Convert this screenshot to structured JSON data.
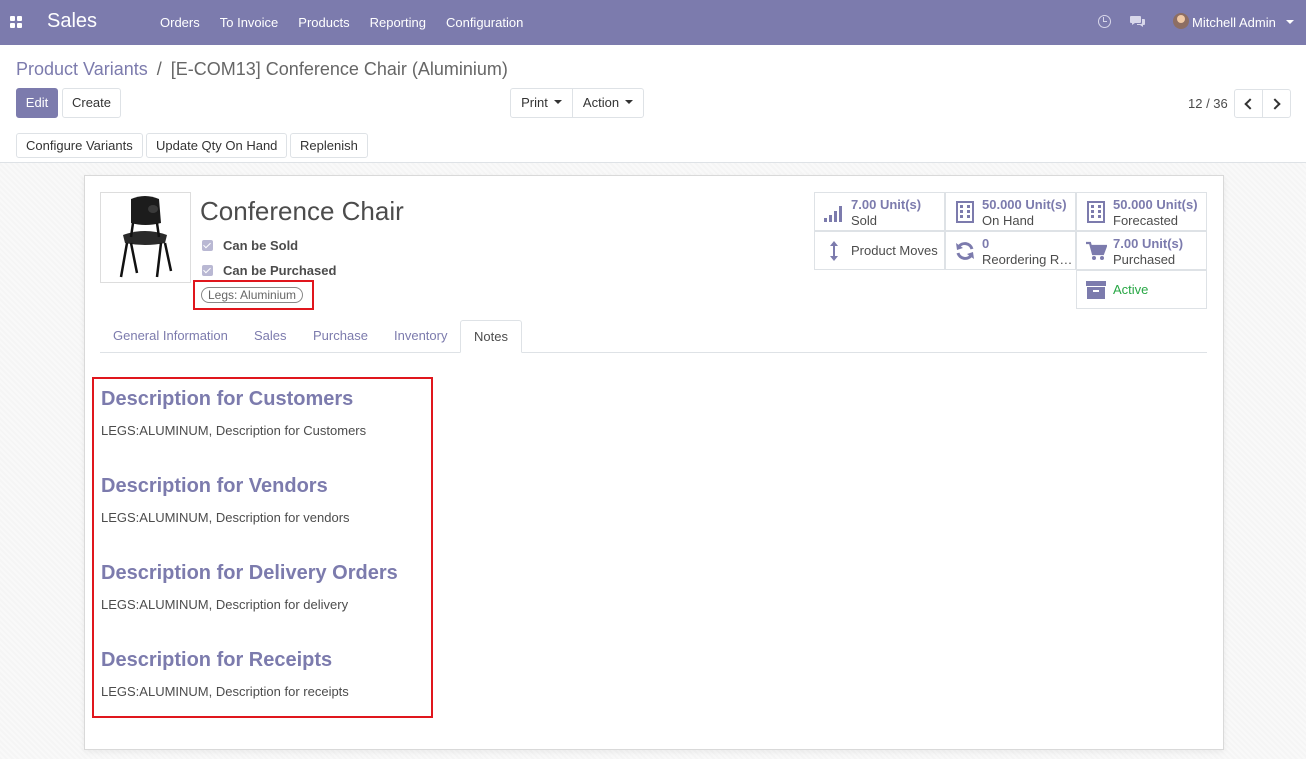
{
  "navbar": {
    "app_name": "Sales",
    "menu": [
      "Orders",
      "To Invoice",
      "Products",
      "Reporting",
      "Configuration"
    ],
    "user": "Mitchell Admin",
    "color": "#7c7bad"
  },
  "breadcrumb": {
    "parent": "Product Variants",
    "separator": "/",
    "current": "[E-COM13] Conference Chair (Aluminium)"
  },
  "buttons": {
    "edit": "Edit",
    "create": "Create",
    "print": "Print",
    "action": "Action"
  },
  "pager": {
    "value": "12 / 36"
  },
  "statusbar": {
    "configure_variants": "Configure Variants",
    "update_qty": "Update Qty On Hand",
    "replenish": "Replenish"
  },
  "product": {
    "name": "Conference Chair",
    "can_be_sold": "Can be Sold",
    "can_be_purchased": "Can be Purchased",
    "attribute_tag": "Legs: Aluminium"
  },
  "smart_buttons": {
    "sold": {
      "value": "7.00",
      "unit": "Unit(s)",
      "label": "Sold",
      "icon": "chart-bars-icon"
    },
    "on_hand": {
      "value": "50.000",
      "unit": "Unit(s)",
      "label": "On Hand",
      "icon": "building-icon"
    },
    "forecasted": {
      "value": "50.000",
      "unit": "Unit(s)",
      "label": "Forecasted",
      "icon": "building-icon"
    },
    "product_moves": {
      "label": "Product Moves",
      "icon": "arrows-v-icon"
    },
    "reordering": {
      "value": "0",
      "label": "Reordering Rules",
      "icon": "refresh-icon"
    },
    "purchased": {
      "value": "7.00",
      "unit": "Unit(s)",
      "label": "Purchased",
      "icon": "cart-icon"
    },
    "active": {
      "label": "Active",
      "icon": "archive-icon",
      "color": "#28a745"
    }
  },
  "tabs": [
    "General Information",
    "Sales",
    "Purchase",
    "Inventory",
    "Notes"
  ],
  "active_tab": "Notes",
  "notes": [
    {
      "title": "Description for Customers",
      "text": "LEGS:ALUMINUM, Description for Customers"
    },
    {
      "title": "Description for Vendors",
      "text": "LEGS:ALUMINUM, Description for vendors"
    },
    {
      "title": "Description for Delivery Orders",
      "text": "LEGS:ALUMINUM, Description for delivery"
    },
    {
      "title": "Description for Receipts",
      "text": "LEGS:ALUMINUM, Description for receipts"
    }
  ],
  "highlight_color": "#e0161d"
}
